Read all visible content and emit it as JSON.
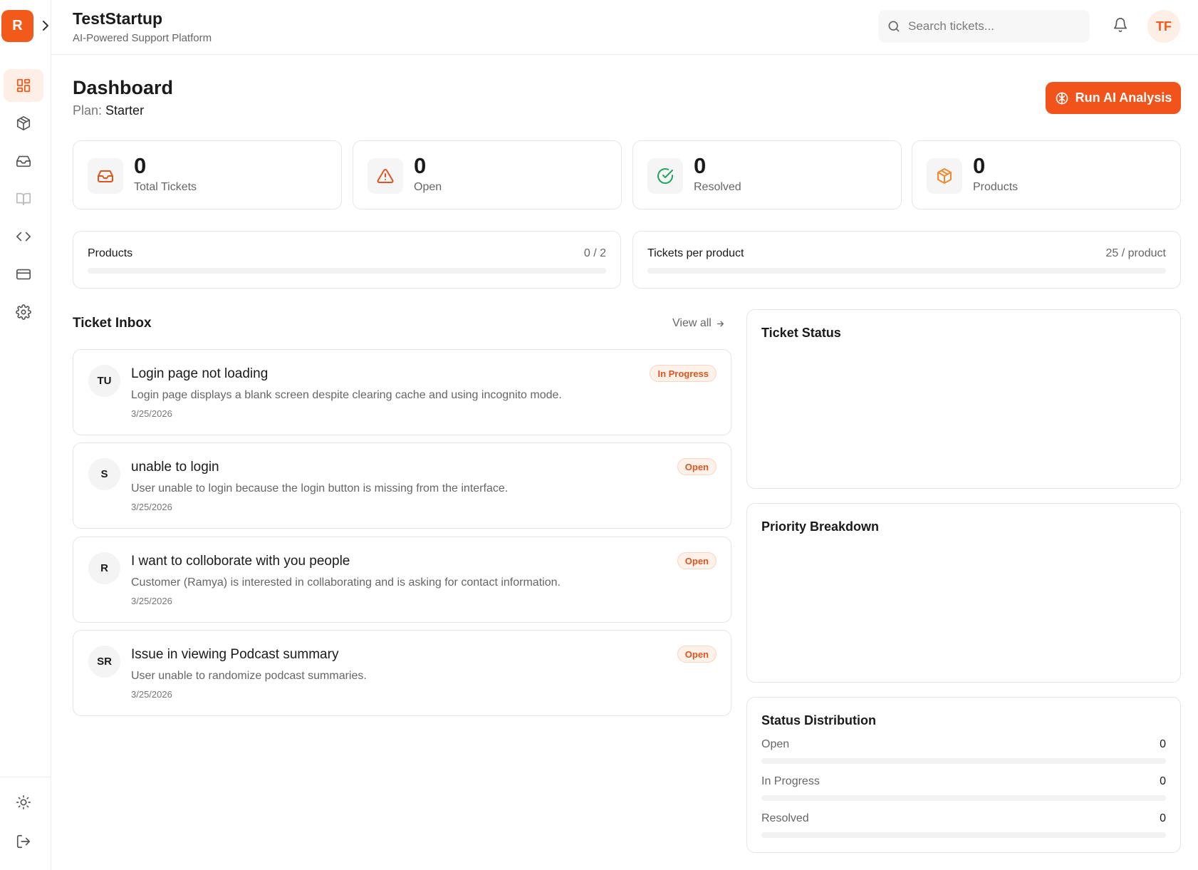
{
  "app": {
    "logo_letter": "R",
    "title": "TestStartup",
    "subtitle": "AI-Powered Support Platform",
    "user_initials": "TF"
  },
  "search": {
    "placeholder": "Search tickets..."
  },
  "sidebar": {
    "items": [
      {
        "name": "dashboard",
        "icon": "grid-icon",
        "active": true
      },
      {
        "name": "products",
        "icon": "cube-icon",
        "active": false
      },
      {
        "name": "inbox",
        "icon": "inbox-icon",
        "active": false
      },
      {
        "name": "docs",
        "icon": "book-icon",
        "active": false
      },
      {
        "name": "developer",
        "icon": "code-icon",
        "active": false
      },
      {
        "name": "billing",
        "icon": "card-icon",
        "active": false
      },
      {
        "name": "settings",
        "icon": "gear-icon",
        "active": false
      }
    ],
    "bottom": [
      {
        "name": "theme",
        "icon": "sun-icon"
      },
      {
        "name": "logout",
        "icon": "logout-icon"
      }
    ]
  },
  "page": {
    "title": "Dashboard",
    "plan_label": "Plan:",
    "plan_value": "Starter",
    "run_button": "Run AI Analysis"
  },
  "stats": [
    {
      "value": "0",
      "label": "Total Tickets",
      "icon": "inbox-icon",
      "color": "#e0541d"
    },
    {
      "value": "0",
      "label": "Open",
      "icon": "warning-icon",
      "color": "#e0541d"
    },
    {
      "value": "0",
      "label": "Resolved",
      "icon": "check-circle-icon",
      "color": "#22a55b"
    },
    {
      "value": "0",
      "label": "Products",
      "icon": "cube-icon",
      "color": "#f08a2c"
    }
  ],
  "usage": [
    {
      "label": "Products",
      "value": "0 / 2",
      "fraction": 0
    },
    {
      "label": "Tickets per product",
      "value": "25 / product",
      "fraction": 0
    }
  ],
  "inbox": {
    "title": "Ticket Inbox",
    "view_all": "View all",
    "tickets": [
      {
        "initials": "TU",
        "title": "Login page not loading",
        "desc": "Login page displays a blank screen despite clearing cache and using incognito mode.",
        "date": "3/25/2026",
        "status": "In Progress"
      },
      {
        "initials": "S",
        "title": "unable to login",
        "desc": "User unable to login because the login button is missing from the interface.",
        "date": "3/25/2026",
        "status": "Open"
      },
      {
        "initials": "R",
        "title": "I want to colloborate with you people",
        "desc": "Customer (Ramya) is interested in collaborating and is asking for contact information.",
        "date": "3/25/2026",
        "status": "Open"
      },
      {
        "initials": "SR",
        "title": "Issue in viewing Podcast summary",
        "desc": "User unable to randomize podcast summaries.",
        "date": "3/25/2026",
        "status": "Open"
      }
    ]
  },
  "panels": {
    "ticket_status": {
      "title": "Ticket Status"
    },
    "priority": {
      "title": "Priority Breakdown"
    },
    "distribution": {
      "title": "Status Distribution",
      "rows": [
        {
          "label": "Open",
          "value": "0",
          "fraction": 0
        },
        {
          "label": "In Progress",
          "value": "0",
          "fraction": 0
        },
        {
          "label": "Resolved",
          "value": "0",
          "fraction": 0
        }
      ]
    }
  },
  "colors": {
    "accent": "#f2531a",
    "accent_soft": "#fdeee6"
  }
}
